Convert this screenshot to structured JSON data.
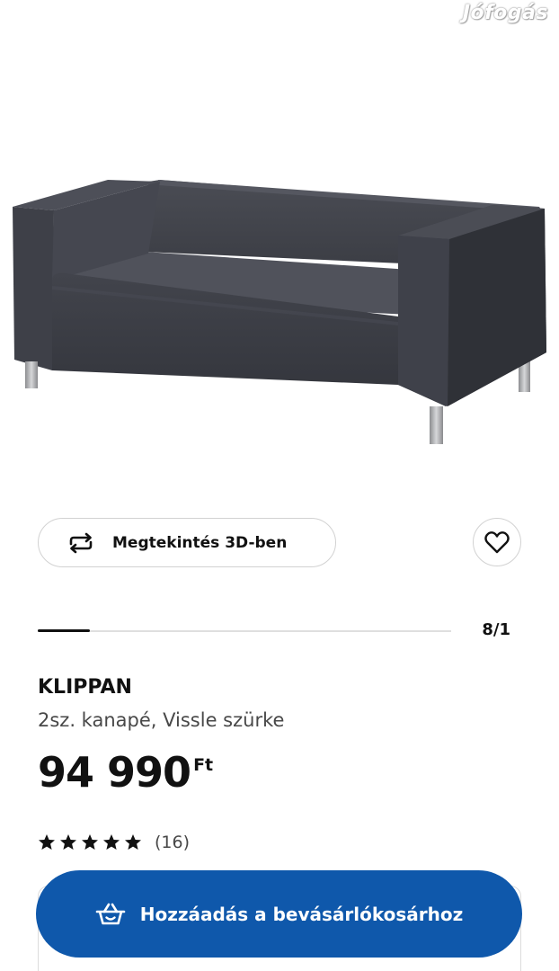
{
  "watermark": "Jófogás",
  "product_image": {
    "subject": "sofa"
  },
  "view_3d": {
    "label": "Megtekintés 3D-ben",
    "icon": "rotate-arrows-icon"
  },
  "favorite": {
    "icon": "heart-icon"
  },
  "gallery": {
    "counter": "8/1",
    "progress": 0.125
  },
  "product": {
    "name": "KLIPPAN",
    "description": "2sz. kanapé, Vissle szürke"
  },
  "price": {
    "amount": "94 990",
    "currency": "Ft"
  },
  "rating": {
    "stars": 5,
    "max": 5,
    "count": "(16)"
  },
  "add_to_cart": {
    "label": "Hozzáadás a bevásárlókosárhoz",
    "icon": "basket-icon"
  },
  "colors": {
    "button_blue": "#0f58ab",
    "sofa_grey": "#3d3f47",
    "text": "#111111",
    "muted_text": "#484848"
  }
}
